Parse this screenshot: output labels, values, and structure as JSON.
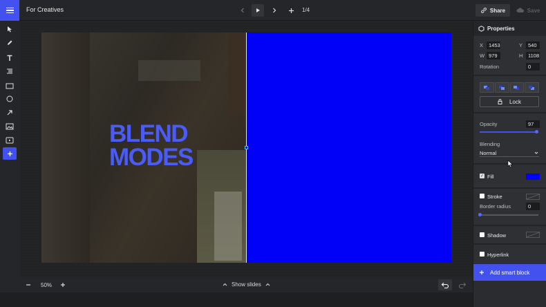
{
  "header": {
    "title": "For Creatives",
    "page_count": "1/4",
    "share_label": "Share",
    "save_label": "Save"
  },
  "toolbar": {
    "tools": [
      "pointer-icon",
      "pen-icon",
      "text-icon",
      "list-icon",
      "rectangle-icon",
      "circle-icon",
      "arrow-icon",
      "image-icon",
      "video-icon",
      "plus-icon"
    ]
  },
  "slide": {
    "headline_line1": "BLEND",
    "headline_line2": "MODES",
    "block_color": "#0000ff",
    "text_color": "#4a5bf6"
  },
  "bottombar": {
    "zoom": "50%",
    "show_slides_label": "Show slides"
  },
  "properties": {
    "title": "Properties",
    "x_label": "X",
    "x_value": "1453",
    "y_label": "Y",
    "y_value": "540",
    "w_label": "W",
    "w_value": "979",
    "h_label": "H",
    "h_value": "1108",
    "rotation_label": "Rotation",
    "rotation_value": "0",
    "lock_label": "Lock",
    "opacity_label": "Opacity",
    "opacity_value": "97",
    "opacity_level": 0.97,
    "blending_label": "Blending",
    "blending_value": "Normal",
    "fill_label": "Fill",
    "fill_color": "#0000ff",
    "fill_checked": true,
    "stroke_label": "Stroke",
    "border_radius_label": "Border radius",
    "border_radius_value": "0",
    "shadow_label": "Shadow",
    "hyperlink_label": "Hyperlink",
    "smart_block_label": "Add smart block"
  }
}
